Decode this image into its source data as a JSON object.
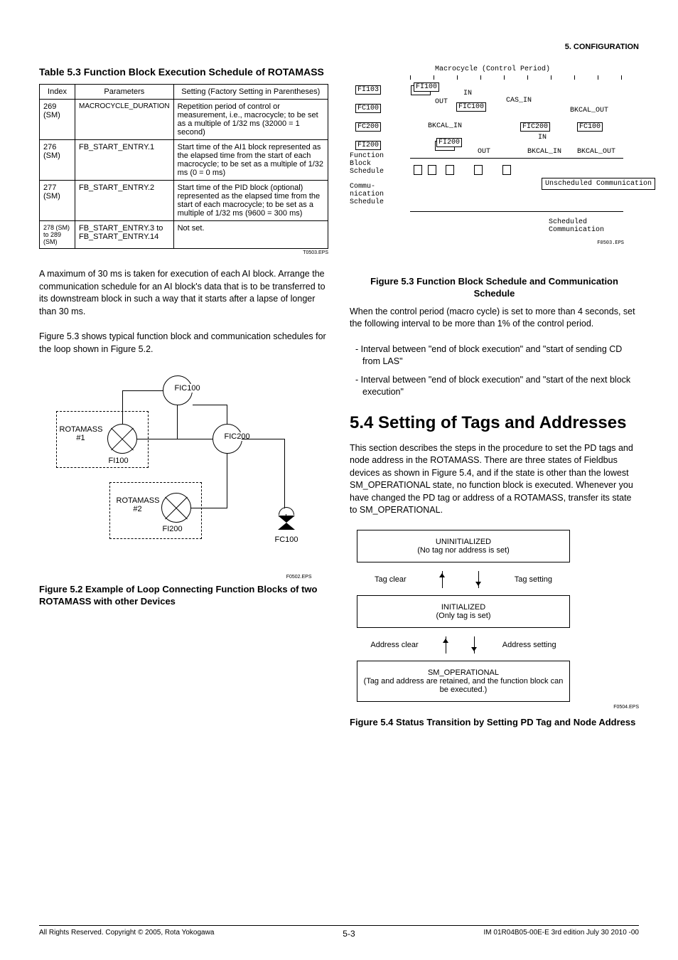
{
  "header": {
    "section": "5.  CONFIGURATION"
  },
  "table53": {
    "title": "Table 5.3 Function Block Execution Schedule of ROTAMASS",
    "head": {
      "c1": "Index",
      "c2": "Parameters",
      "c3": "Setting (Factory Setting in Parentheses)"
    },
    "rows": [
      {
        "c1": "269 (SM)",
        "c2": "MACROCYCLE_DURATION",
        "c3": "Repetition period of control or measurement, i.e., macrocycle; to be set as a multiple of 1/32 ms (32000 = 1 second)"
      },
      {
        "c1": "276 (SM)",
        "c2": "FB_START_ENTRY.1",
        "c3": "Start time of the AI1 block represented as the elapsed time from the start of each macrocycle; to be set as a multiple of 1/32 ms (0 = 0 ms)"
      },
      {
        "c1": "277 (SM)",
        "c2": "FB_START_ENTRY.2",
        "c3": "Start time of the PID block (optional) represented as the elapsed time from the start of each macrocycle; to be set as a multiple of 1/32 ms (9600 = 300 ms)"
      },
      {
        "c1": "278 (SM) to 289 (SM)",
        "c2": "FB_START_ENTRY.3 to FB_START_ENTRY.14",
        "c3": "Not set."
      }
    ],
    "eps": "T0503.EPS"
  },
  "para1": "A maximum of 30 ms is taken for execution of each AI block.  Arrange the communication schedule for an AI block's data that is to be transferred to its downstream block in such a way that it starts after a lapse of longer than 30 ms.",
  "para2": "Figure 5.3 shows typical function block and communication schedules for the loop shown in Figure 5.2.",
  "fig52": {
    "caption": "Figure 5.2 Example of Loop Connecting Function Blocks of two ROTAMASS with other Devices",
    "eps": "F0502.EPS",
    "labels": {
      "rota1": "ROTAMASS #1",
      "rota2": "ROTAMASS #2",
      "fi100": "FI100",
      "fi200": "FI200",
      "fic100": "FIC100",
      "fic200": "FIC200",
      "fc100": "FC100"
    }
  },
  "fig53": {
    "title": "Macrocycle (Control Period)",
    "caption": "Figure 5.3 Function Block Schedule and Communication Schedule",
    "eps": "F0503.EPS",
    "labels": {
      "fi103": "FI103",
      "fi100": "FI100",
      "fc100": "FC100",
      "fic100": "FIC100",
      "fc200": "FC200",
      "fic200": "FIC200",
      "fc100b": "FC100",
      "fi200l": "FI200",
      "fi200r": "FI200",
      "in1": "IN",
      "out1": "OUT",
      "cas_in": "CAS_IN",
      "bkcal_out": "BKCAL_OUT",
      "bkcal_in": "BKCAL_IN",
      "in2": "IN",
      "out2": "OUT",
      "bkcal_in2": "BKCAL_IN",
      "bkcal_out2": "BKCAL_OUT",
      "fbs": "Function Block Schedule",
      "comm": "Commu-nication Schedule",
      "unsched": "Unscheduled Communication",
      "sched": "Scheduled Communication"
    }
  },
  "para3": "When the control period (macro cycle) is set to more than 4 seconds, set the following interval to be more than 1% of the control period.",
  "bullets": [
    "- Interval between \"end of block execution\" and \"start of sending CD from LAS\"",
    "- Interval between \"end of block execution\" and \"start of the next block execution\""
  ],
  "section54": {
    "heading": "5.4  Setting of Tags and Addresses",
    "body": "This section describes the steps in the procedure to set the PD tags and node address in the ROTAMASS. There are three states of Fieldbus devices as shown in Figure 5.4, and if the state is other than the lowest SM_OPERATIONAL state, no function block is executed. Whenever you have changed the PD tag or address of a ROTAMASS, transfer its state to SM_OPERATIONAL."
  },
  "fig54": {
    "caption": "Figure 5.4  Status Transition by Setting PD Tag and Node Address",
    "eps": "F0504.EPS",
    "state1": {
      "t1": "UNINITIALIZED",
      "t2": "(No tag nor address is set)"
    },
    "state2": {
      "t1": "INITIALIZED",
      "t2": "(Only tag is set)"
    },
    "state3": {
      "t1": "SM_OPERATIONAL",
      "t2": "(Tag and address are retained, and the function block can be executed.)"
    },
    "arrows": {
      "tag_clear": "Tag clear",
      "tag_setting": "Tag setting",
      "addr_clear": "Address clear",
      "addr_setting": "Address setting"
    }
  },
  "footer": {
    "left": "All Rights Reserved. Copyright © 2005, Rota Yokogawa",
    "mid": "5-3",
    "right": "IM 01R04B05-00E-E    3rd edition July 30 2010 -00"
  }
}
